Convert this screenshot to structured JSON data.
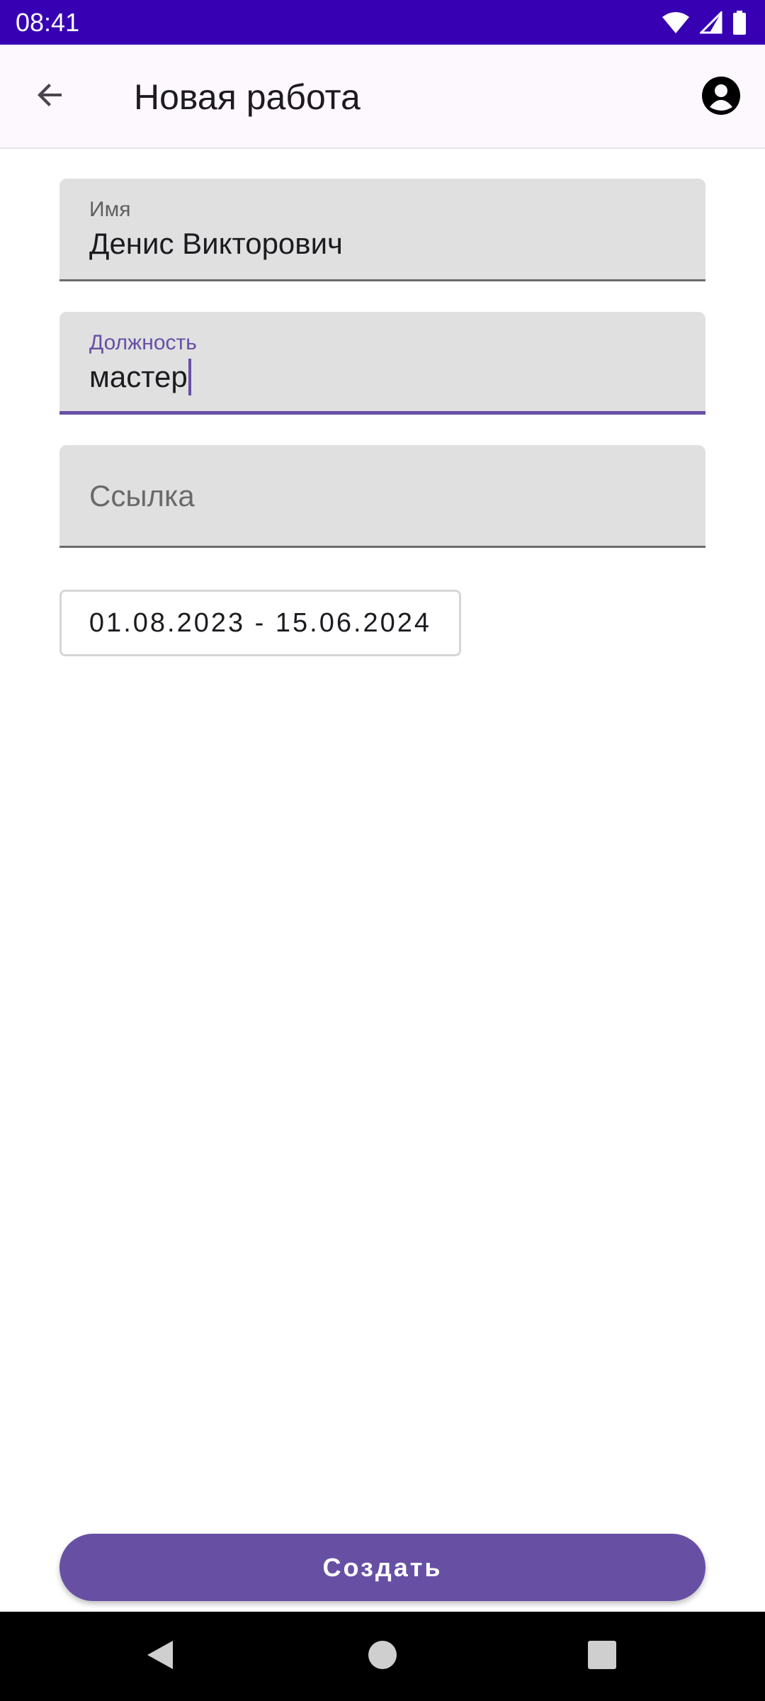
{
  "status_bar": {
    "time": "08:41",
    "icons": [
      "wifi-icon",
      "signal-icon",
      "battery-icon"
    ]
  },
  "app_bar": {
    "title": "Новая работа",
    "back_icon": "arrow-back-icon",
    "account_icon": "account-circle-icon"
  },
  "form": {
    "name": {
      "label": "Имя",
      "value": "Денис Викторович"
    },
    "position": {
      "label": "Должность",
      "value": "мастер",
      "focused": true
    },
    "link": {
      "placeholder": "Ссылка",
      "value": ""
    },
    "date_range": "01.08.2023 - 15.06.2024"
  },
  "actions": {
    "create_label": "Создать"
  },
  "colors": {
    "status_bar": "#3700b3",
    "app_bar": "#fdf7fe",
    "primary": "#6750a4",
    "field_bg": "#e0e0e0"
  }
}
